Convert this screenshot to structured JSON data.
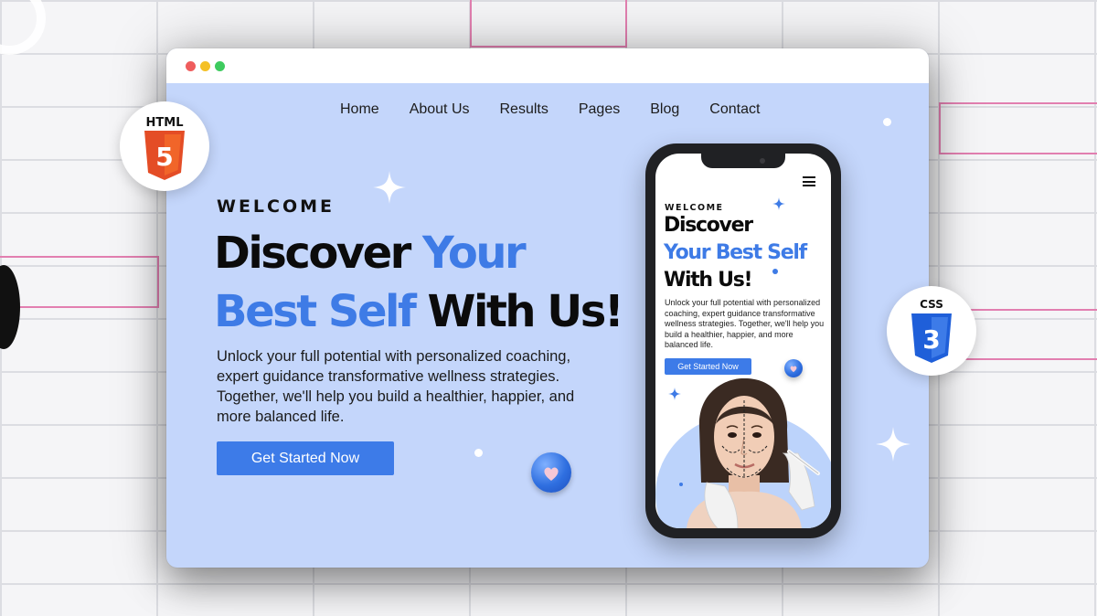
{
  "background": {
    "grid_color": "#dcdde2",
    "accent_outline_color": "#e27fb0"
  },
  "browser": {
    "window_controls": [
      "close-dot",
      "minimize-dot",
      "maximize-dot"
    ],
    "nav": [
      "Home",
      "About Us",
      "Results",
      "Pages",
      "Blog",
      "Contact"
    ],
    "hero": {
      "eyebrow": "WELCOME",
      "headline_part1": "Discover ",
      "headline_part2": "Your Best Self",
      "headline_part3": " With Us!",
      "lead": "Unlock your full potential with personalized coaching, expert guidance transformative wellness strategies. Together, we'll help you build a healthier, happier, and more balanced life.",
      "cta": "Get Started Now"
    },
    "colors": {
      "accent": "#3e7be6",
      "page_bg": "#c4d6fb",
      "button": "#3d7be8"
    }
  },
  "phone": {
    "eyebrow": "WELCOME",
    "headline_line1": "Discover",
    "headline_line2": "Your Best Self",
    "headline_line3": "With Us!",
    "lead": "Unlock your full potential with personalized coaching, expert guidance transformative wellness strategies. Together, we'll help you build a healthier, happier, and more balanced life.",
    "cta": "Get Started Now",
    "menu_icon": "hamburger-icon"
  },
  "badges": {
    "html": {
      "label": "HTML",
      "number": "5",
      "color": "#e44d26"
    },
    "css": {
      "label": "CSS",
      "number": "3",
      "color": "#2965f1"
    }
  }
}
